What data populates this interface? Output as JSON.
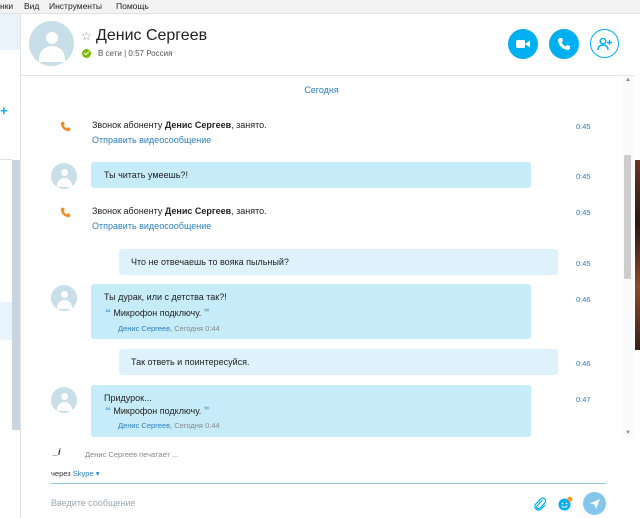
{
  "menu": {
    "items": [
      "нки",
      "Вид",
      "Инструменты",
      "Помощь"
    ]
  },
  "left_strip": {
    "plus": "+"
  },
  "header": {
    "contact_name": "Денис Сергеев",
    "status": "В сети | 0:57 Россия"
  },
  "chat": {
    "date_separator": "Сегодня",
    "call1": {
      "prefix": "Звонок абоненту ",
      "name": "Денис Сергеев",
      "suffix": ", занято.",
      "link": "Отправить видеосообщение",
      "time": "0:45"
    },
    "msg1": {
      "text": "Ты читать умеешь?!",
      "time": "0:45"
    },
    "call2": {
      "prefix": "Звонок абоненту ",
      "name": "Денис Сергеев",
      "suffix": ", занято.",
      "link": "Отправить видеосообщение",
      "time": "0:45"
    },
    "msg2": {
      "text": "Что не отвечаешь то вояка пыльный?",
      "time": "0:45"
    },
    "msg3": {
      "text": "Ты дурак, или с детства так?!",
      "quote": "Микрофон подключу.",
      "quote_author": "Денис Сергеев,",
      "quote_time": "Сегодня 0:44",
      "time": "0:46"
    },
    "msg4": {
      "text": "Так ответь и поинтересуйся.",
      "time": "0:46"
    },
    "msg5": {
      "text": "Придурок...",
      "quote": "Микрофон подключу.",
      "quote_author": "Денис Сергеев,",
      "quote_time": "Сегодня 0:44",
      "time": "0:47"
    }
  },
  "typing": {
    "icon": "_i",
    "text": "Денис Сергеев печатает ..."
  },
  "composer": {
    "via_label": "через",
    "via_service": "Skype ▾",
    "placeholder": "Введите сообщение"
  },
  "colors": {
    "accent": "#00aff0",
    "bubble_in": "#c7ecf9",
    "link": "#2a7fbf",
    "online": "#7fba00",
    "call_icon": "#f28c1e"
  }
}
